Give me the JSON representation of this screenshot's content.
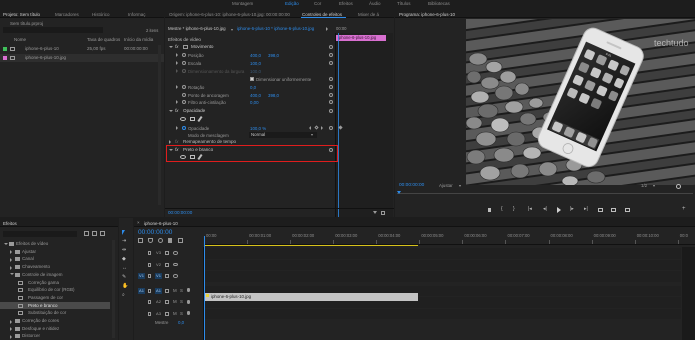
{
  "menu": {
    "items": [
      "Montagem",
      "Edição",
      "Cor",
      "Efeitos",
      "Áudio",
      "Títulos",
      "Bibliotecas"
    ],
    "active_index": 1
  },
  "project_panel": {
    "tabs": [
      "Projeto: Sem título",
      "Marcadores",
      "Histórico",
      "Informaç"
    ],
    "project_name": "Sem título.prproj",
    "item_count": "2 itens",
    "columns": [
      "Nome",
      "Taxa de quadros",
      "Início da mídia"
    ],
    "rows": [
      {
        "name": "iphone-6-plus-10",
        "rate": "25,00 fps",
        "start": "00:00:00:00",
        "color": "#3fbf5a"
      },
      {
        "name": "iphone-6-plus-10.jpg",
        "rate": "",
        "start": "",
        "color": "#d86fd0"
      }
    ]
  },
  "effect_controls": {
    "tabs": [
      "Origem: iphone-6-plus-10: iphone-6-plus-10.jpg: 00:00:00:00",
      "Controles de efeitos",
      "Mixer de á"
    ],
    "master_label": "Mestre * iphone-6-plus-10.jpg",
    "sequence_label": "iphone-6-plus-10 * iphone-6-plus-10.jpg",
    "ruler_time": "00:00",
    "clip_chip": "iphone-6-plus-10.jpg",
    "section_video": "Efeitos de vídeo",
    "fx_motion": "Movimento",
    "position_label": "Posição",
    "position_x": "400,0",
    "position_y": "398,0",
    "scale_label": "Escala",
    "scale_value": "100,0",
    "scale_width_label": "Dimensionamento da largura",
    "scale_width_value": "100,0",
    "uniform_scale_label": "Dimensionar uniformemente",
    "rotation_label": "Rotação",
    "rotation_value": "0,0",
    "anchor_label": "Ponto de ancoragem",
    "anchor_x": "400,0",
    "anchor_y": "398,0",
    "antiflicker_label": "Filtro anti-cintilação",
    "antiflicker_value": "0,00",
    "fx_opacity": "Opacidade",
    "opacity_label": "Opacidade",
    "opacity_value": "100,0 %",
    "blend_label": "Modo de mesclagem",
    "blend_value": "Normal",
    "time_remap": "Remapeamento de tempo",
    "fx_bw": "Preto e branco",
    "timecode": "00:00:00:00"
  },
  "program_monitor": {
    "tab": "Programa: iphone-6-plus-10",
    "timecode": "00:00:00:00",
    "fit": "Ajustar",
    "ratio": "1/2",
    "watermark": "techtudo",
    "phone_time": "9:41"
  },
  "effects_panel": {
    "title": "Efeitos",
    "tree": [
      {
        "label": "Efeitos de vídeo",
        "level": 0,
        "open": true
      },
      {
        "label": "Ajustar",
        "level": 1,
        "open": false
      },
      {
        "label": "Canal",
        "level": 1,
        "open": false
      },
      {
        "label": "Chaveamento",
        "level": 1,
        "open": false
      },
      {
        "label": "Controle de imagem",
        "level": 1,
        "open": true
      },
      {
        "label": "Correção gama",
        "level": 2,
        "open": false
      },
      {
        "label": "Equilíbrio de cor (RGB)",
        "level": 2,
        "open": false
      },
      {
        "label": "Passagem de cor",
        "level": 2,
        "open": false
      },
      {
        "label": "Preto e branco",
        "level": 2,
        "open": false,
        "selected": true
      },
      {
        "label": "Substituição de cor",
        "level": 2,
        "open": false
      },
      {
        "label": "Correção de cores",
        "level": 1,
        "open": false
      },
      {
        "label": "Desfoque e nitidez",
        "level": 1,
        "open": false
      },
      {
        "label": "Distorcer",
        "level": 1,
        "open": false
      }
    ]
  },
  "timeline": {
    "tab": "iphone-6-plus-10",
    "timecode": "00:00:00:00",
    "ruler": [
      "00:00",
      "00:00:01:00",
      "00:00:02:00",
      "00:00:03:00",
      "00:00:04:00",
      "00:00:05:00",
      "00:00:06:00",
      "00:00:07:00",
      "00:00:08:00",
      "00:00:09:00",
      "00:00:10:00",
      "00:0"
    ],
    "tracks": [
      {
        "name": "V3",
        "type": "video"
      },
      {
        "name": "V2",
        "type": "video"
      },
      {
        "name": "V1",
        "type": "video",
        "source": "V1"
      },
      {
        "name": "A1",
        "type": "audio",
        "source": "A1"
      },
      {
        "name": "A2",
        "type": "audio"
      },
      {
        "name": "A3",
        "type": "audio"
      }
    ],
    "clip_label": "iphone-6-plus-10.jpg",
    "master_label": "Mestre",
    "master_value": "0,0"
  }
}
